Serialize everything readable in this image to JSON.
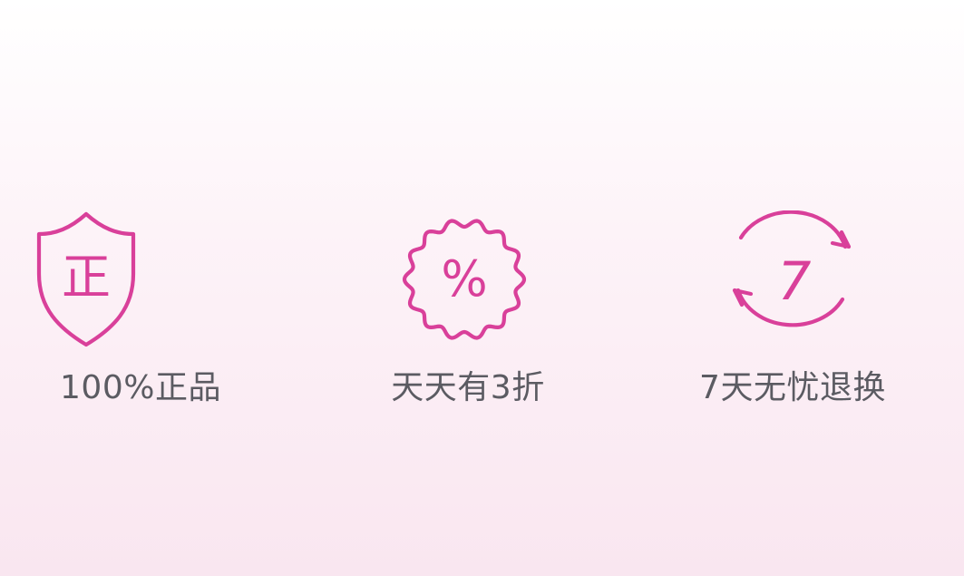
{
  "accent_color": "#d9409a",
  "label_color": "#5b5b62",
  "features": [
    {
      "icon": "shield-genuine-icon",
      "icon_glyph": "正",
      "label": "100%正品"
    },
    {
      "icon": "discount-badge-icon",
      "icon_glyph": "%",
      "label": "天天有3折"
    },
    {
      "icon": "seven-day-return-icon",
      "icon_glyph": "7",
      "label": "7天无忧退换"
    }
  ]
}
